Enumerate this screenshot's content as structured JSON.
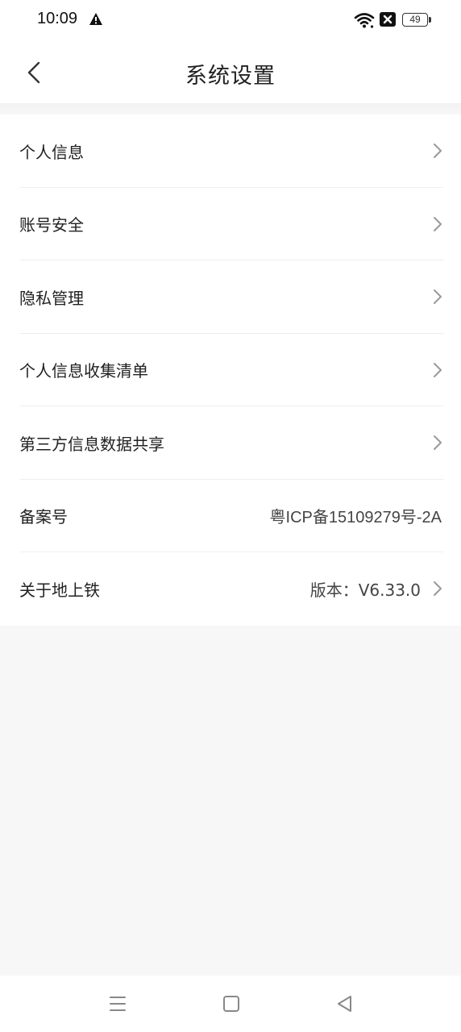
{
  "status_bar": {
    "time": "10:09",
    "battery_level": "49",
    "icons": [
      "warning-icon",
      "wifi-icon",
      "no-signal-icon",
      "battery-icon"
    ]
  },
  "header": {
    "title": "系统设置",
    "back_icon": "chevron-left-icon"
  },
  "settings": {
    "items": [
      {
        "label": "个人信息",
        "value": "",
        "has_chevron": true
      },
      {
        "label": "账号安全",
        "value": "",
        "has_chevron": true
      },
      {
        "label": "隐私管理",
        "value": "",
        "has_chevron": true
      },
      {
        "label": "个人信息收集清单",
        "value": "",
        "has_chevron": true
      },
      {
        "label": "第三方信息数据共享",
        "value": "",
        "has_chevron": true
      },
      {
        "label": "备案号",
        "value": "粤ICP备15109279号-2A",
        "has_chevron": false
      },
      {
        "label": "关于地上铁",
        "value": "版本：V6.33.0",
        "has_chevron": true
      }
    ]
  },
  "nav_bar": {
    "icons": [
      "menu-icon",
      "home-square-icon",
      "back-triangle-icon"
    ]
  },
  "colors": {
    "background": "#f7f7f7",
    "surface": "#ffffff",
    "divider": "#efefef",
    "text": "#222222",
    "chevron": "#999999"
  }
}
